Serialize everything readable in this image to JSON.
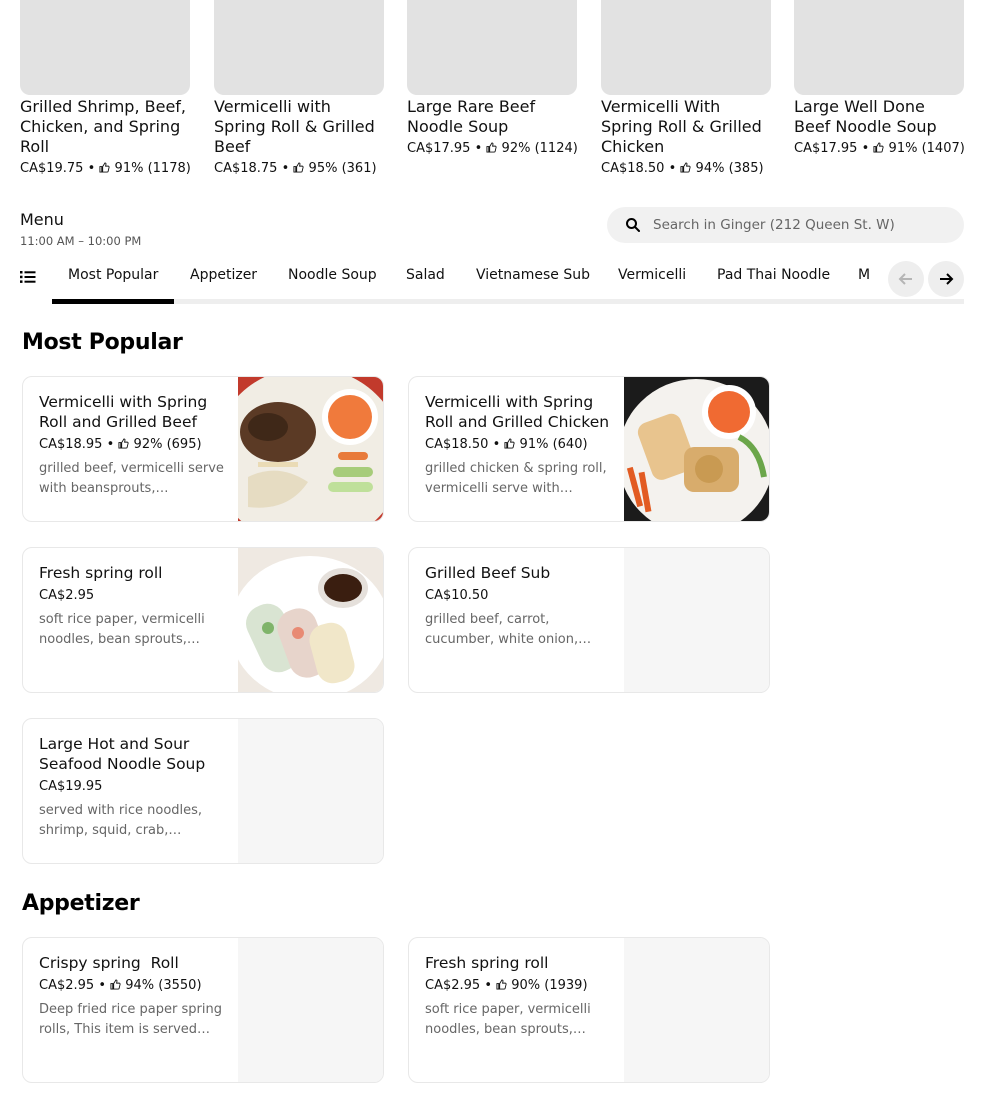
{
  "carousel": [
    {
      "title": "Grilled Shrimp, Beef, Chicken, and Spring Roll",
      "price": "CA$19.75",
      "rating": "91% (1178)"
    },
    {
      "title": "Vermicelli with Spring Roll & Grilled Beef",
      "price": "CA$18.75",
      "rating": "95% (361)"
    },
    {
      "title": "Large Rare Beef Noodle Soup",
      "price": "CA$17.95",
      "rating": "92% (1124)"
    },
    {
      "title": "Vermicelli With Spring Roll & Grilled Chicken",
      "price": "CA$18.50",
      "rating": "94% (385)"
    },
    {
      "title": "Large Well Done Beef Noodle Soup",
      "price": "CA$17.95",
      "rating": "91% (1407)"
    }
  ],
  "menu": {
    "title": "Menu",
    "hours": "11:00 AM – 10:00 PM"
  },
  "search": {
    "placeholder": "Search in Ginger (212 Queen St. W)"
  },
  "tabs": [
    "Most Popular",
    "Appetizer",
    "Noodle Soup",
    "Salad",
    "Vietnamese Sub",
    "Vermicelli",
    "Pad Thai Noodle",
    "M"
  ],
  "active_tab": "Most Popular",
  "sections": {
    "most_popular": {
      "title": "Most Popular",
      "items": [
        {
          "name": "Vermicelli with Spring Roll and Grilled Beef",
          "price": "CA$18.95",
          "rating": "92% (695)",
          "desc": "grilled beef, vermicelli serve with beansprouts,…"
        },
        {
          "name": "Vermicelli with Spring Roll and Grilled Chicken",
          "price": "CA$18.50",
          "rating": "91% (640)",
          "desc": "grilled chicken & spring roll, vermicelli serve with…"
        },
        {
          "name": "Fresh spring roll",
          "price": "CA$2.95",
          "desc": "soft rice paper, vermicelli noodles, bean sprouts,…"
        },
        {
          "name": "Grilled Beef Sub",
          "price": "CA$10.50",
          "desc": "grilled beef, carrot, cucumber, white onion,…"
        },
        {
          "name": "Large Hot and Sour Seafood Noodle Soup",
          "price": "CA$19.95",
          "desc": "served with rice noodles, shrimp, squid, crab,…"
        }
      ]
    },
    "appetizer": {
      "title": "Appetizer",
      "items": [
        {
          "name": "Crispy spring  Roll",
          "price": "CA$2.95",
          "rating": "94% (3550)",
          "desc": "Deep fried rice paper spring rolls, This item is served…"
        },
        {
          "name": "Fresh spring roll",
          "price": "CA$2.95",
          "rating": "90% (1939)",
          "desc": "soft rice paper, vermicelli noodles, bean sprouts,…"
        }
      ]
    }
  },
  "colors": {
    "accent": "#000000",
    "placeholder_bg": "#e2e2e2",
    "muted_text": "#666666"
  }
}
